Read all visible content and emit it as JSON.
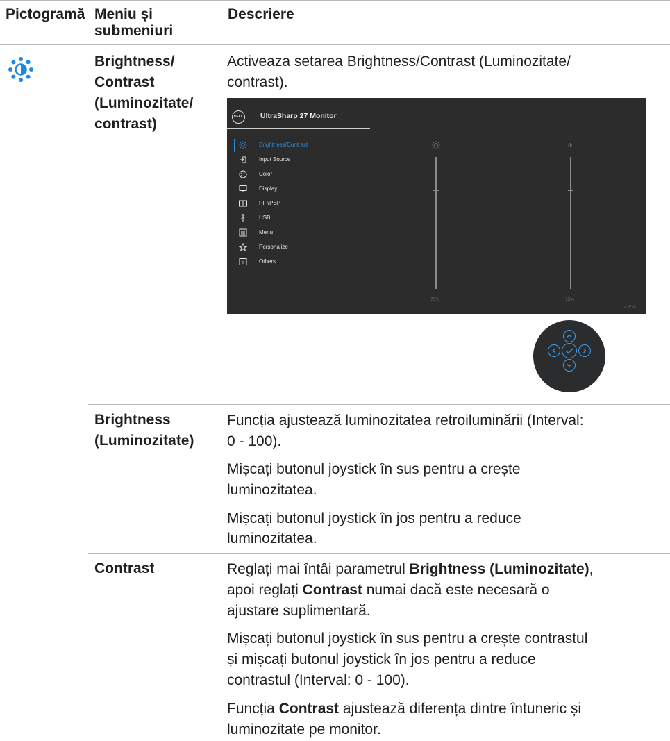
{
  "header": {
    "col_icon": "Pictogramă",
    "col_menu_line1": "Meniu și",
    "col_menu_line2": "submeniuri",
    "col_desc": "Descriere"
  },
  "main_row": {
    "icon": "brightness-contrast-icon",
    "name_lines": [
      "Brightness/",
      "Contrast",
      "(Luminozitate/",
      "contrast)"
    ],
    "desc_line1": "Activeaza setarea Brightness/Contrast (Luminozitate/",
    "desc_line2": "contrast)."
  },
  "osd": {
    "brand": "DELL",
    "title": "UltraSharp 27 Monitor",
    "menu": [
      {
        "label": "Brightness/Contrast",
        "icon": "sun-icon",
        "active": true
      },
      {
        "label": "Input Source",
        "icon": "input-source-icon",
        "active": false
      },
      {
        "label": "Color",
        "icon": "color-icon",
        "active": false
      },
      {
        "label": "Display",
        "icon": "display-icon",
        "active": false
      },
      {
        "label": "PIP/PBP",
        "icon": "pip-pbp-icon",
        "active": false
      },
      {
        "label": "USB",
        "icon": "usb-icon",
        "active": false
      },
      {
        "label": "Menu",
        "icon": "menu-icon",
        "active": false
      },
      {
        "label": "Personalize",
        "icon": "star-icon",
        "active": false
      },
      {
        "label": "Others",
        "icon": "others-icon",
        "active": false
      }
    ],
    "brightness_value": "75%",
    "brightness_level": 75,
    "contrast_value": "75%",
    "contrast_level": 75,
    "exit_label": "Exit",
    "exit_icon": "chevron-left-icon"
  },
  "joystick": {
    "buttons": [
      "chevron-up-icon",
      "chevron-left-icon",
      "check-icon",
      "chevron-right-icon",
      "chevron-down-icon"
    ],
    "accent": "#3aa0f5"
  },
  "brightness_row": {
    "name_line1": "Brightness",
    "name_line2": "(Luminozitate)",
    "p1_line1": "Funcția ajustează luminozitatea retroiluminării (Interval:",
    "p1_line2": "0 - 100).",
    "p2_line1": "Mișcați butonul joystick în sus pentru a crește",
    "p2_line2": "luminozitatea.",
    "p3_line1": "Mișcați butonul joystick în jos pentru a reduce",
    "p3_line2": "luminozitatea."
  },
  "contrast_row": {
    "name": "Contrast",
    "p1_a": "Reglați mai întâi parametrul ",
    "p1_b": "Brightness (Luminozitate)",
    "p1_c": ",",
    "p1_d": "apoi reglați ",
    "p1_e": "Contrast",
    "p1_f": " numai dacă este necesară o",
    "p1_g": "ajustare suplimentară.",
    "p2_line1": "Mișcați butonul joystick în sus pentru a crește contrastul",
    "p2_line2": "și mișcați butonul joystick în jos pentru a reduce",
    "p2_line3": "contrastul (Interval: 0 - 100).",
    "p3_a": "Funcția ",
    "p3_b": "Contrast",
    "p3_c": " ajustează diferența dintre întuneric și",
    "p3_line2": "luminozitate pe monitor."
  },
  "colors": {
    "text": "#231f20",
    "rule": "#b9b9b9",
    "osd_bg": "#2c2c2c",
    "osd_accent": "#2d8ee0",
    "icon_blue": "#1e88e5"
  }
}
